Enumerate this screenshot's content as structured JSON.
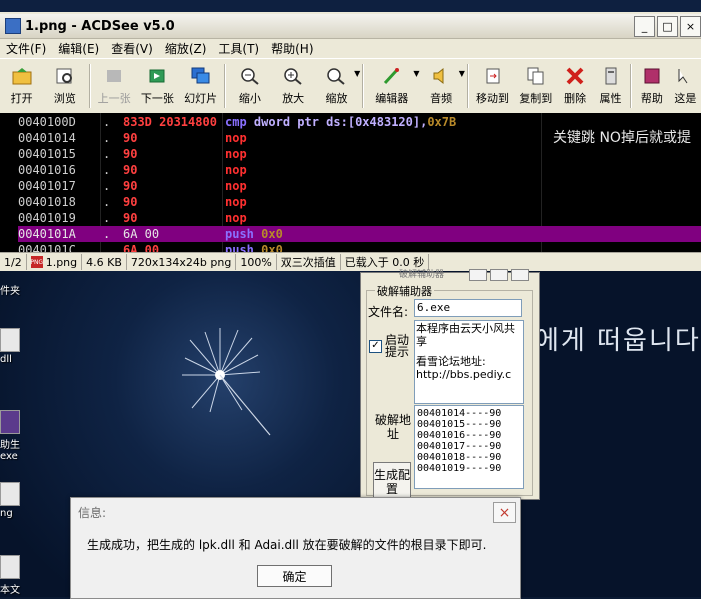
{
  "acdsee": {
    "title": "1.png - ACDSee v5.0",
    "window_buttons": [
      "_",
      "□",
      "×"
    ],
    "menu": [
      "文件(F)",
      "编辑(E)",
      "查看(V)",
      "缩放(Z)",
      "工具(T)",
      "帮助(H)"
    ],
    "toolbar": {
      "open": "打开",
      "browse": "浏览",
      "prev": "上一张",
      "next": "下一张",
      "slideshow": "幻灯片",
      "zoom_out": "缩小",
      "zoom_in": "放大",
      "zoom": "缩放",
      "editor": "编辑器",
      "audio": "音频",
      "move_to": "移动到",
      "copy_to": "复制到",
      "delete": "删除",
      "properties": "属性",
      "help": "帮助",
      "this_is": "这是"
    },
    "overlay_text": "关键跳 NO掉后就或提",
    "disasm": [
      {
        "addr": "0040100D",
        "dot": ".",
        "hex": "833D 20314800",
        "asm_kw": "cmp",
        "asm_op": "dword ptr ds:[0x483120],",
        "asm_num": "0x7B"
      },
      {
        "addr": "00401014",
        "dot": ".",
        "hex": "90",
        "asm_kw": "nop",
        "asm_op": "",
        "asm_num": ""
      },
      {
        "addr": "00401015",
        "dot": ".",
        "hex": "90",
        "asm_kw": "nop",
        "asm_op": "",
        "asm_num": ""
      },
      {
        "addr": "00401016",
        "dot": ".",
        "hex": "90",
        "asm_kw": "nop",
        "asm_op": "",
        "asm_num": ""
      },
      {
        "addr": "00401017",
        "dot": ".",
        "hex": "90",
        "asm_kw": "nop",
        "asm_op": "",
        "asm_num": ""
      },
      {
        "addr": "00401018",
        "dot": ".",
        "hex": "90",
        "asm_kw": "nop",
        "asm_op": "",
        "asm_num": ""
      },
      {
        "addr": "00401019",
        "dot": ".",
        "hex": "90",
        "asm_kw": "nop",
        "asm_op": "",
        "asm_num": ""
      },
      {
        "addr": "0040101A",
        "dot": ".",
        "hex": "6A 00",
        "asm_kw": "push",
        "asm_op": "",
        "asm_num": "0x0"
      },
      {
        "addr": "0040101C",
        "dot": ".",
        "hex": "6A 00",
        "asm_kw": "push",
        "asm_op": "",
        "asm_num": "0x0"
      }
    ],
    "status": {
      "index": "1/2",
      "file": "1.png",
      "size": "4.6 KB",
      "dims": "720x134x24b png",
      "zoom": "100%",
      "interp": "双三次插值",
      "load": "已载入于 0.0 秒"
    }
  },
  "desktop": {
    "icons": [
      "件夹",
      "dll",
      "助生",
      "exe",
      "ng",
      "本文"
    ],
    "korean_text": "에게 떠웁니다"
  },
  "helper": {
    "ghost_title": "破解辅助器",
    "group_title": "破解辅助器",
    "file_label": "文件名:",
    "file_value": "6.exe",
    "checkbox_label": "启动提示",
    "checkbox_mark": "✓",
    "info_line1": "本程序由云天小风共享",
    "info_line2": "看雪论坛地址:",
    "info_line3": "http://bbs.pediy.c",
    "crack_addr_label": "破解地址",
    "addresses": [
      "00401014----90",
      "00401015----90",
      "00401016----90",
      "00401017----90",
      "00401018----90",
      "00401019----90"
    ],
    "generate_label": "生成配置"
  },
  "msgbox": {
    "title": "信息:",
    "text": "生成成功，把生成的 lpk.dll 和 Adai.dll 放在要破解的文件的根目录下即可.",
    "ok": "确定",
    "close": "×"
  }
}
